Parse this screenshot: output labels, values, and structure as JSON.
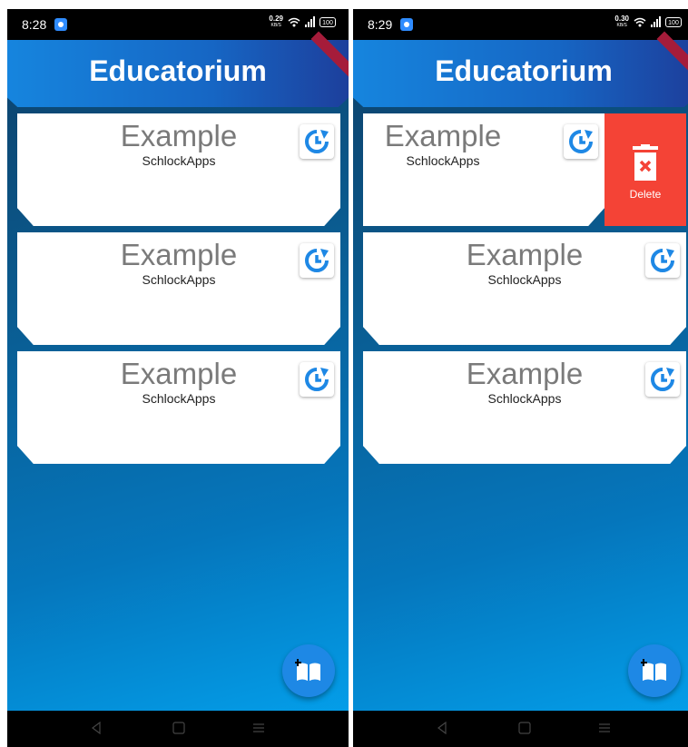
{
  "screens": [
    {
      "status": {
        "time": "8:28",
        "net_speed": "0.29",
        "net_unit": "KB/S",
        "battery": "100"
      },
      "appbar": {
        "title": "Educatorium"
      },
      "cards": [
        {
          "title": "Example",
          "author": "SchlockApps"
        },
        {
          "title": "Example",
          "author": "SchlockApps"
        },
        {
          "title": "Example",
          "author": "SchlockApps"
        }
      ]
    },
    {
      "status": {
        "time": "8:29",
        "net_speed": "0.30",
        "net_unit": "KB/S",
        "battery": "100"
      },
      "appbar": {
        "title": "Educatorium"
      },
      "cards": [
        {
          "title": "Example",
          "author": "SchlockApps",
          "delete_label": "Delete"
        },
        {
          "title": "Example",
          "author": "SchlockApps"
        },
        {
          "title": "Example",
          "author": "SchlockApps"
        }
      ]
    }
  ],
  "icons": {
    "card_action": "history-icon",
    "fab": "book-add-icon",
    "delete": "trash-icon",
    "nav": [
      "back-icon",
      "home-icon",
      "menu-icon"
    ]
  },
  "colors": {
    "appbar": "#1666c4",
    "fab": "#1e88e5",
    "delete": "#f44336",
    "accent_icon": "#1e88e5"
  }
}
